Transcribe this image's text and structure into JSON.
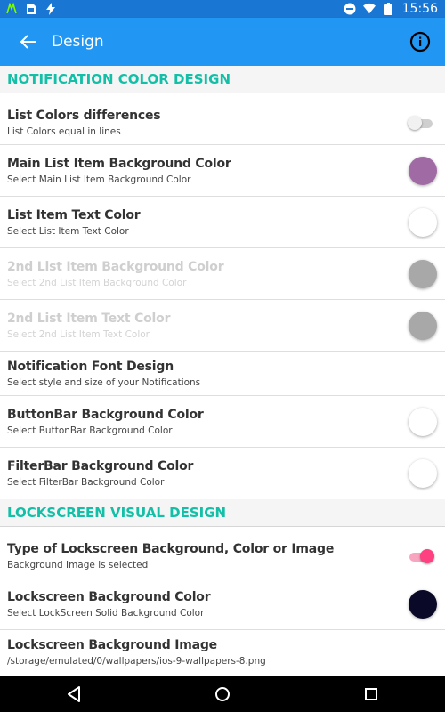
{
  "status_bar": {
    "time": "15:56",
    "left_icons": [
      "android-icon",
      "sim-card-icon",
      "flash-icon"
    ],
    "right_icons": [
      "do-not-disturb-icon",
      "wifi-icon",
      "battery-icon"
    ]
  },
  "app_bar": {
    "title": "Design",
    "color": "#2196f3"
  },
  "sections": [
    {
      "title": "NOTIFICATION COLOR DESIGN",
      "items": [
        {
          "title": "List Colors differences",
          "subtitle": "List Colors equal in lines",
          "control": "toggle",
          "state": "off",
          "enabled": true
        },
        {
          "title": "Main List Item Background Color",
          "subtitle": "Select Main List Item Background Color",
          "control": "swatch",
          "color": "#a06aa4",
          "enabled": true
        },
        {
          "title": "List Item Text Color",
          "subtitle": "Select List Item Text Color",
          "control": "swatch",
          "color": "#ffffff",
          "enabled": true
        },
        {
          "title": "2nd List Item Background Color",
          "subtitle": "Select 2nd List Item Background Color",
          "control": "swatch",
          "color": "#a8a8a8",
          "enabled": false
        },
        {
          "title": "2nd List Item Text Color",
          "subtitle": "Select 2nd List Item Text Color",
          "control": "swatch",
          "color": "#a8a8a8",
          "enabled": false
        },
        {
          "title": "Notification Font Design",
          "subtitle": "Select style and size of your Notifications",
          "control": "none",
          "enabled": true
        },
        {
          "title": "ButtonBar Background Color",
          "subtitle": "Select ButtonBar Background Color",
          "control": "swatch",
          "color": "#ffffff",
          "enabled": true
        },
        {
          "title": "FilterBar Background Color",
          "subtitle": "Select FilterBar Background Color",
          "control": "swatch",
          "color": "#ffffff",
          "enabled": true
        }
      ]
    },
    {
      "title": "LOCKSCREEN VISUAL DESIGN",
      "items": [
        {
          "title": "Type of Lockscreen Background, Color or Image",
          "subtitle": "Background Image is selected",
          "control": "toggle",
          "state": "on",
          "enabled": true
        },
        {
          "title": "Lockscreen Background Color",
          "subtitle": "Select LockScreen Solid Background Color",
          "control": "swatch",
          "color": "#0a0a28",
          "enabled": true
        },
        {
          "title": "Lockscreen Background Image",
          "subtitle": "/storage/emulated/0/wallpapers/ios-9-wallpapers-8.png",
          "control": "none",
          "enabled": true
        }
      ]
    }
  ],
  "nav_bar": {
    "buttons": [
      "back-triangle-icon",
      "home-circle-icon",
      "recents-square-icon"
    ]
  },
  "colors": {
    "accent": "#13bfa6",
    "toggle_on": "#ff4081"
  }
}
